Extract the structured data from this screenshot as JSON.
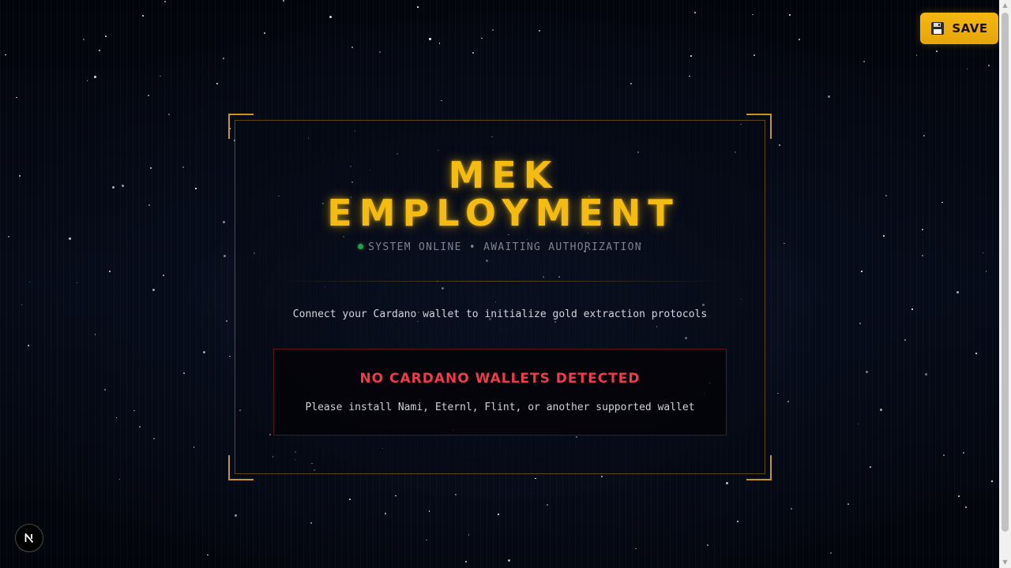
{
  "header": {
    "save_label": "SAVE",
    "save_icon": "floppy-disk-icon"
  },
  "card": {
    "title_line1": "MEK",
    "title_line2": "EMPLOYMENT",
    "status_text": "SYSTEM ONLINE • AWAITING AUTHORIZATION",
    "status_indicator_color": "#1fa24a",
    "subtitle": "Connect your Cardano wallet to initialize gold extraction protocols"
  },
  "error": {
    "title": "NO CARDANO WALLETS DETECTED",
    "message": "Please install Nami, Eternl, Flint, or another supported wallet"
  },
  "dev_badge": {
    "icon": "nextjs-n-icon",
    "letter": "N"
  },
  "colors": {
    "accent_gold": "#f4bb13",
    "frame_gold": "#c8961a",
    "error_red": "#f03c4a",
    "background": "#02040a"
  }
}
